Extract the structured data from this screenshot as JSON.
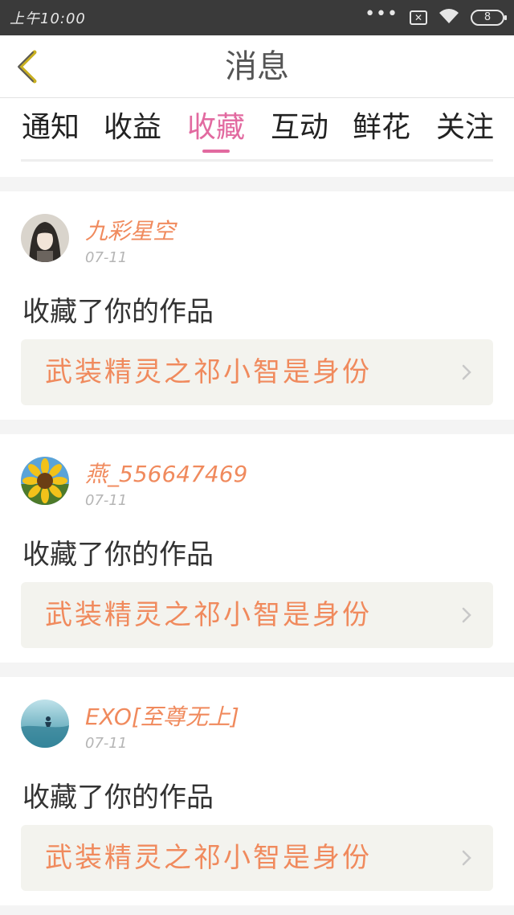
{
  "status_bar": {
    "time": "上午10:00",
    "signal_dots": "•••",
    "sim_label": "✕",
    "battery": "8"
  },
  "nav": {
    "title": "消息"
  },
  "tabs": [
    {
      "label": "通知",
      "active": false
    },
    {
      "label": "收益",
      "active": false
    },
    {
      "label": "收藏",
      "active": true
    },
    {
      "label": "互动",
      "active": false
    },
    {
      "label": "鲜花",
      "active": false
    },
    {
      "label": "关注",
      "active": false
    }
  ],
  "items": [
    {
      "username": "九彩星空",
      "date": "07-11",
      "action": "收藏了你的作品",
      "work_title": "武装精灵之祁小智是身份",
      "avatar": "anime-girl-avatar"
    },
    {
      "username": "燕_556647469",
      "date": "07-11",
      "action": "收藏了你的作品",
      "work_title": "武装精灵之祁小智是身份",
      "avatar": "sunflower-avatar"
    },
    {
      "username": "EXO[至尊无上]",
      "date": "07-11",
      "action": "收藏了你的作品",
      "work_title": "武装精灵之祁小智是身份",
      "avatar": "ocean-avatar"
    }
  ],
  "colors": {
    "accent": "#e26aa0",
    "username": "#f08a5d",
    "work_box": "#f3f3ee",
    "status_bar": "#3a3a3a"
  }
}
